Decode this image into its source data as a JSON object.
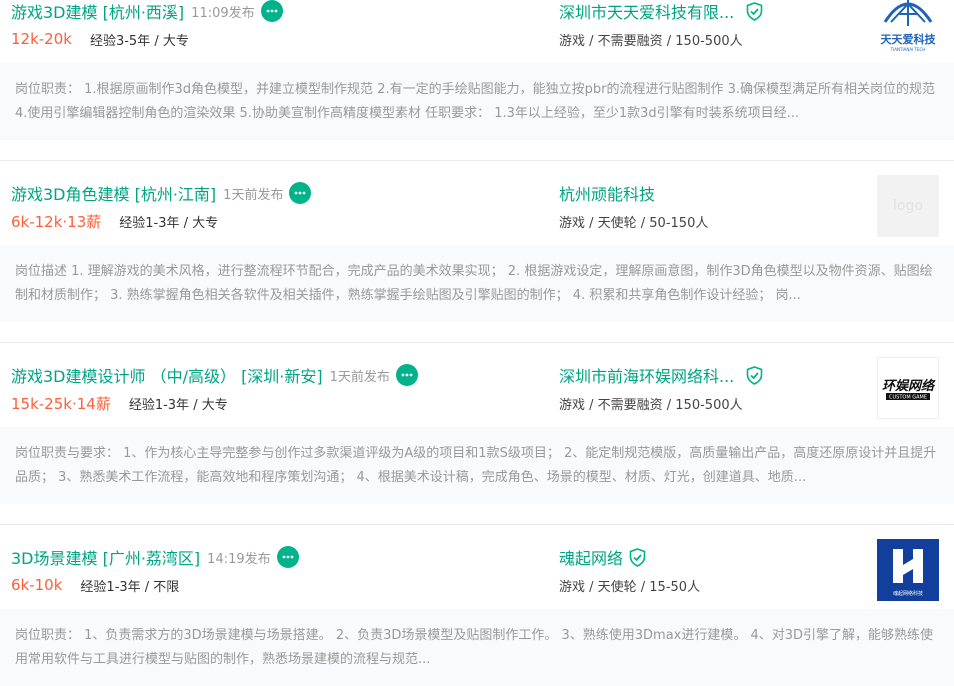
{
  "jobs": [
    {
      "title": "游戏3D建模 [杭州·西溪]",
      "time": "11:09发布",
      "salary": "12k-20k",
      "requirement": "经验3-5年 / 大专",
      "company": "深圳市天天爱科技有限...",
      "company_info": "游戏 / 不需要融资 / 150-500人",
      "verified": true,
      "logo_text": "天天爱科技",
      "logo_sub": "TIANTIANAI TECH",
      "description": "岗位职责： 1.根据原画制作3d角色模型，并建立模型制作规范 2.有一定的手绘贴图能力，能独立按pbr的流程进行贴图制作 3.确保模型满足所有相关岗位的规范 4.使用引擎编辑器控制角色的渲染效果 5.协助美宣制作高精度模型素材 任职要求： 1.3年以上经验，至少1款3d引擎有时装系统项目经..."
    },
    {
      "title": "游戏3D角色建模 [杭州·江南]",
      "time": "1天前发布",
      "salary": "6k-12k·13薪",
      "requirement": "经验1-3年 / 大专",
      "company": "杭州顽能科技",
      "company_info": "游戏 / 天使轮 / 50-150人",
      "verified": false,
      "logo_text": "logo",
      "description": "岗位描述 1. 理解游戏的美术风格，进行整流程环节配合，完成产品的美术效果实现； 2. 根据游戏设定，理解原画意图，制作3D角色模型以及物件资源、贴图绘制和材质制作； 3. 熟练掌握角色相关各软件及相关插件，熟练掌握手绘贴图及引擎贴图的制作； 4. 积累和共享角色制作设计经验； 岗..."
    },
    {
      "title": "游戏3D建模设计师 （中/高级） [深圳·新安]",
      "time": "1天前发布",
      "salary": "15k-25k·14薪",
      "requirement": "经验1-3年 / 大专",
      "company": "深圳市前海环娱网络科...",
      "company_info": "游戏 / 不需要融资 / 150-500人",
      "verified": true,
      "logo_text": "环娱网络",
      "logo_sub": "CUSTOM GAME",
      "description": "岗位职责与要求： 1、作为核心主导完整参与创作过多款渠道评级为A级的项目和1款S级项目； 2、能定制规范模版，高质量输出产品，高度还原原设计并且提升品质； 3、熟悉美术工作流程，能高效地和程序策划沟通； 4、根据美术设计稿，完成角色、场景的模型、材质、灯光，创建道具、地质..."
    },
    {
      "title": "3D场景建模 [广州·荔湾区]",
      "time": "14:19发布",
      "salary": "6k-10k",
      "requirement": "经验1-3年 / 不限",
      "company": "魂起网络",
      "company_info": "游戏 / 天使轮 / 15-50人",
      "verified": true,
      "logo_text": "魂起网络科技",
      "description": "岗位职责： 1、负责需求方的3D场景建模与场景搭建。 2、负责3D场景模型及贴图制作工作。 3、熟练使用3Dmax进行建模。 4、对3D引擎了解，能够熟练使用常用软件与工具进行模型与贴图的制作，熟悉场景建模的流程与规范..."
    }
  ],
  "colors": {
    "accent": "#00a485",
    "salary": "#fd5f39",
    "desc_bg": "#f9fafb"
  }
}
